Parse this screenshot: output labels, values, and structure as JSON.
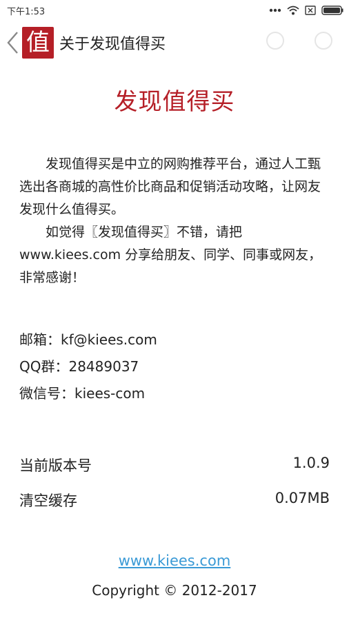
{
  "status_bar": {
    "time": "下午1:53",
    "icons": [
      "more-dots-icon",
      "wifi-icon",
      "sim-card-icon",
      "battery-icon"
    ]
  },
  "header": {
    "back_icon": "chevron-left-icon",
    "logo_char": "值",
    "title": "关于发现值得买"
  },
  "app_name": "发现值得买",
  "intro": {
    "paragraph1": "发现值得买是中立的网购推荐平台，通过人工甄选出各商城的高性价比商品和促销活动攻略，让网友发现什么值得买。",
    "paragraph2": "如觉得〖发现值得买〗不错，请把www.kiees.com 分享给朋友、同学、同事或网友，非常感谢！"
  },
  "contacts": {
    "email": "邮箱：kf@kiees.com",
    "qq_group": "QQ群：28489037",
    "wechat": "微信号：kiees-com"
  },
  "version": {
    "label": "当前版本号",
    "value": "1.0.9"
  },
  "cache": {
    "label": "清空缓存",
    "value": "0.07MB"
  },
  "footer": {
    "website": "www.kiees.com",
    "copyright": "Copyright © 2012-2017"
  },
  "colors": {
    "brand": "#b51f27",
    "link": "#3a9ad6"
  }
}
